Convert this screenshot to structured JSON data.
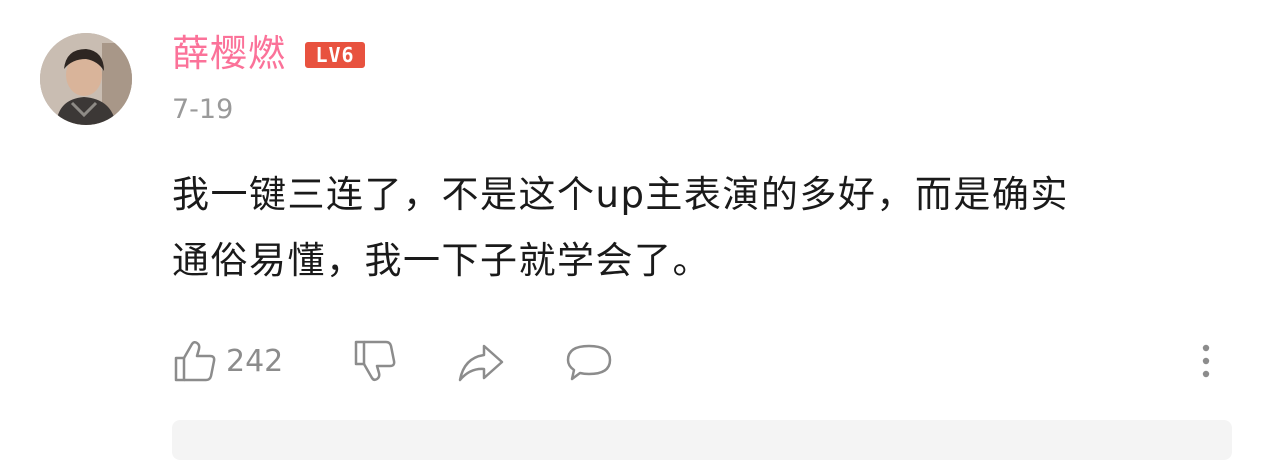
{
  "comment": {
    "username": "薛樱燃",
    "level_badge": "LV6",
    "date": "7-19",
    "text_line1": "我一键三连了，不是这个up主表演的多好，而是确实",
    "text_line2": "通俗易懂，我一下子就学会了。",
    "like_count": "242"
  },
  "colors": {
    "username": "#fb7299",
    "level_badge": "#e8523f",
    "meta_gray": "#9a9a9a",
    "text": "#1a1a1a"
  },
  "icons": [
    "avatar",
    "thumbs-up-icon",
    "thumbs-down-icon",
    "share-icon",
    "reply-icon",
    "more-vertical-icon"
  ]
}
